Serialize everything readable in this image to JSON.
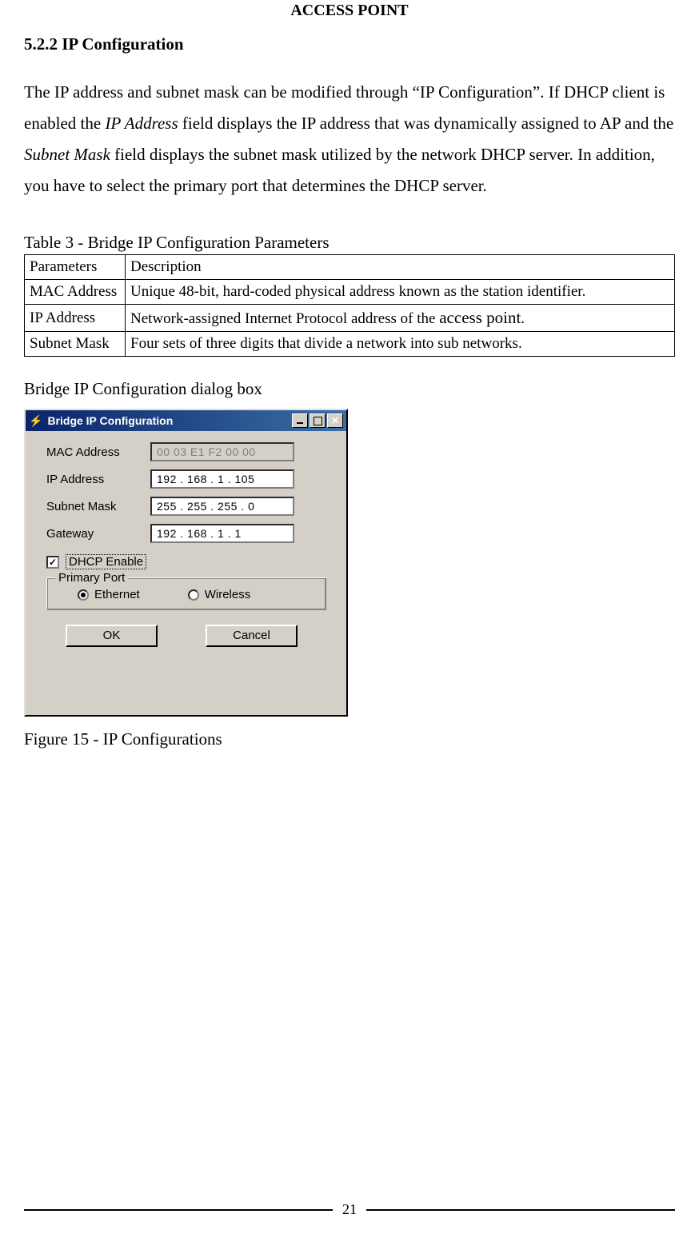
{
  "header": {
    "title": "ACCESS POINT"
  },
  "section": {
    "heading": "5.2.2 IP Configuration"
  },
  "paragraph": {
    "t1": "The IP address and subnet mask can be modified through “IP Configuration”. If DHCP client is enabled the ",
    "i1": "IP Address",
    "t2": " field displays the IP address that was dynamically assigned to AP and the ",
    "i2": "Subnet Mask",
    "t3": " field displays the subnet mask utilized by the network DHCP server. In addition, you have to select the primary port that determines the DHCP server."
  },
  "table": {
    "caption": "Table 3 - Bridge IP Configuration Parameters",
    "header": {
      "c1": "Parameters",
      "c2": "Description"
    },
    "rows": [
      {
        "param": "MAC Address",
        "desc": "Unique 48-bit, hard-coded physical address known as the station identifier."
      },
      {
        "param": "IP Address",
        "desc_pre": "Network-assigned Internet Protocol address of the ",
        "desc_big": "access point",
        "desc_post": "."
      },
      {
        "param": "Subnet Mask",
        "desc": "Four sets of three digits that divide a network into sub networks."
      }
    ]
  },
  "dialog_caption_top": "Bridge IP Configuration dialog box",
  "dialog": {
    "title": "Bridge IP Configuration",
    "fields": {
      "mac": {
        "label": "MAC Address",
        "value": "00 03 E1 F2 00 00"
      },
      "ip": {
        "label": "IP Address",
        "value": "192 . 168 .   1   . 105"
      },
      "subnet": {
        "label": "Subnet Mask",
        "value": "255 . 255 . 255 .   0"
      },
      "gateway": {
        "label": "Gateway",
        "value": "192 . 168 .   1   .   1"
      }
    },
    "dhcp": {
      "label": "DHCP Enable",
      "checked": "✓"
    },
    "primary_port": {
      "legend": "Primary Port",
      "ethernet": "Ethernet",
      "wireless": "Wireless"
    },
    "buttons": {
      "ok": "OK",
      "cancel": "Cancel"
    },
    "close_glyph": "✕"
  },
  "figure_caption": "Figure 15 - IP Configurations",
  "page_number": "21"
}
